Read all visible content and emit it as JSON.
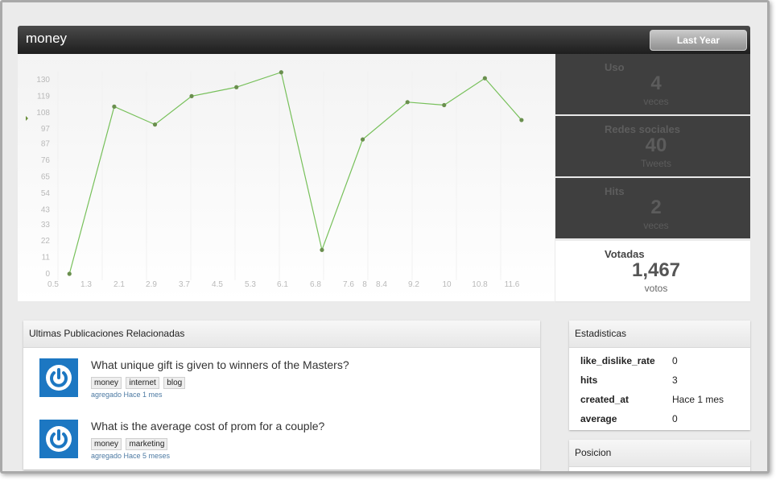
{
  "header": {
    "title": "money",
    "range_button": "Last Year"
  },
  "chart_data": {
    "type": "line",
    "x": [
      0.9,
      2.0,
      3.0,
      3.9,
      5.0,
      6.1,
      7.1,
      8.1,
      9.2,
      10.1,
      11.1,
      12.0
    ],
    "values": [
      0,
      112,
      100,
      119,
      125,
      135,
      16,
      90,
      115,
      113,
      131,
      103
    ],
    "x_ticks": [
      "0.5",
      "1.3",
      "2.1",
      "2.9",
      "3.7",
      "4.5",
      "5.3",
      "6.1",
      "6.8",
      "7.6",
      "8",
      "8.4",
      "9.2",
      "10",
      "10.8",
      "11.6"
    ],
    "y_ticks": [
      "0",
      "11",
      "22",
      "33",
      "43",
      "54",
      "65",
      "76",
      "87",
      "97",
      "108",
      "119",
      "130"
    ],
    "line_color": "#77c05a"
  },
  "stats": [
    {
      "label": "Uso",
      "value": "4",
      "unit": "veces"
    },
    {
      "label": "Redes sociales",
      "value": "40",
      "unit": "Tweets"
    },
    {
      "label": "Hits",
      "value": "2",
      "unit": "veces"
    },
    {
      "label": "Votadas",
      "value": "1,467",
      "unit": "votos"
    }
  ],
  "posts_panel": {
    "title": "Ultimas Publicaciones Relacionadas",
    "items": [
      {
        "title": "What unique gift is given to winners of the Masters?",
        "tags": [
          "money",
          "internet",
          "blog"
        ],
        "meta": "agregado Hace 1 mes"
      },
      {
        "title": "What is the average cost of prom for a couple?",
        "tags": [
          "money",
          "marketing"
        ],
        "meta": "agregado Hace 5 meses"
      }
    ]
  },
  "estadisticas": {
    "title": "Estadisticas",
    "rows": [
      {
        "key": "like_dislike_rate",
        "value": "0"
      },
      {
        "key": "hits",
        "value": "3"
      },
      {
        "key": "created_at",
        "value": "Hace 1 mes"
      },
      {
        "key": "average",
        "value": "0"
      }
    ]
  },
  "posicion": {
    "title": "Posicion"
  }
}
